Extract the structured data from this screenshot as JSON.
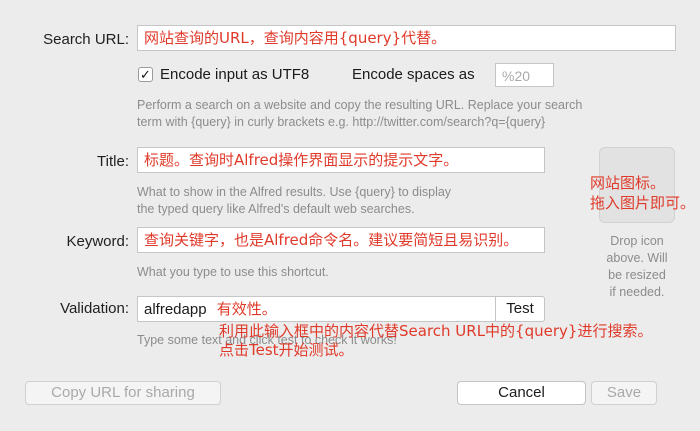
{
  "search_url": {
    "label": "Search URL:",
    "value": "网站查询的URL，查询内容用{query}代替。"
  },
  "encode": {
    "checkbox_mark": "✓",
    "utf8_label": "Encode input as UTF8",
    "spaces_label": "Encode spaces as",
    "spaces_value": "%20",
    "help_line1": "Perform a search on a website and copy the resulting URL. Replace your search",
    "help_line2": "term with {query} in curly brackets e.g. http://twitter.com/search?q={query}"
  },
  "title": {
    "label": "Title:",
    "value": "标题。查询时Alfred操作界面显示的提示文字。",
    "help_line1": "What to show in the Alfred results. Use {query} to display",
    "help_line2": "the typed query like Alfred's default web searches."
  },
  "icon_well": {
    "annotation_line1": "网站图标。",
    "annotation_line2": "拖入图片即可。",
    "drop_line1": "Drop icon",
    "drop_line2": "above. Will",
    "drop_line3": "be resized",
    "drop_line4": "if needed."
  },
  "keyword": {
    "label": "Keyword:",
    "value": "查询关键字，也是Alfred命令名。建议要简短且易识别。",
    "help": "What you type to use this shortcut."
  },
  "validation": {
    "label": "Validation:",
    "value": "alfredapp",
    "annotation": "有效性。",
    "test_button": "Test",
    "help": "Type some text and click test to check it works!",
    "note_line1": "利用此输入框中的内容代替Search URL中的{query}进行搜索。",
    "note_line2": "点击Test开始测试。"
  },
  "footer": {
    "copy_button": "Copy URL for sharing",
    "cancel_button": "Cancel",
    "save_button": "Save"
  },
  "colors": {
    "annotation": "#e03a2a",
    "background": "#ececec",
    "help_text": "#8c8c8c"
  }
}
